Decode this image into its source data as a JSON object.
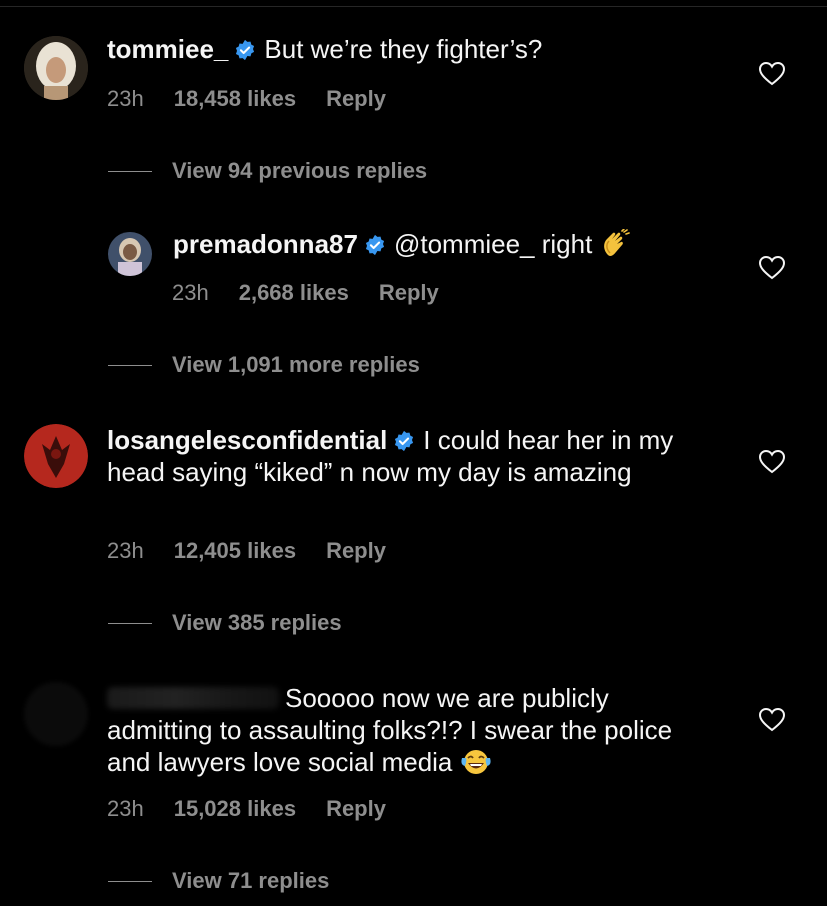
{
  "comments": [
    {
      "username": "tommiee_",
      "text": "But we’re they fighter’s?",
      "time": "23h",
      "likes": "18,458 likes",
      "reply": "Reply",
      "thread": "View 94 previous replies"
    },
    {
      "username": "premadonna87",
      "mention": "@tommiee_",
      "text": " right",
      "emoji": "clapping-hands",
      "time": "23h",
      "likes": "2,668 likes",
      "reply": "Reply",
      "thread": "View 1,091 more replies"
    },
    {
      "username": "losangelesconfidential",
      "text": "I could hear her in my head saying “kiked” n now my day is amazing",
      "time": "23h",
      "likes": "12,405 likes",
      "reply": "Reply",
      "thread": "View 385 replies"
    },
    {
      "username": "",
      "text": "Sooooo now we are publicly admitting to assaulting folks?!? I swear the police and lawyers love social media",
      "emoji": "tears-of-joy",
      "time": "23h",
      "likes": "15,028 likes",
      "reply": "Reply",
      "thread": "View 71 replies"
    }
  ],
  "colors": {
    "background": "#000000",
    "primary_text": "#f5f5f5",
    "secondary_text": "#8e8e8e",
    "verified_badge": "#3897f0"
  }
}
